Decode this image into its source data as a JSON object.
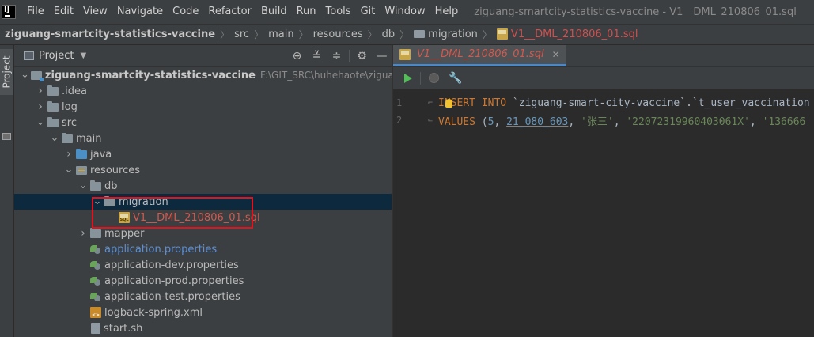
{
  "menubar": {
    "items": [
      "File",
      "Edit",
      "View",
      "Navigate",
      "Code",
      "Refactor",
      "Build",
      "Run",
      "Tools",
      "Git",
      "Window",
      "Help"
    ],
    "window_title": "ziguang-smartcity-statistics-vaccine - V1__DML_210806_01.sql"
  },
  "breadcrumb": {
    "items": [
      "ziguang-smartcity-statistics-vaccine",
      "src",
      "main",
      "resources",
      "db",
      "migration",
      "V1__DML_210806_01.sql"
    ]
  },
  "toolstrip": {
    "project_tab": "Project"
  },
  "project_panel": {
    "title": "Project",
    "tree": [
      {
        "depth": 0,
        "arrow": "open",
        "icon": "module",
        "label": "ziguang-smartcity-statistics-vaccine",
        "style": "bold",
        "path": "F:\\GIT_SRC\\huhehaote\\ziguang-smar"
      },
      {
        "depth": 1,
        "arrow": "closed",
        "icon": "folder",
        "label": ".idea",
        "style": ""
      },
      {
        "depth": 1,
        "arrow": "closed",
        "icon": "folder",
        "label": "log",
        "style": ""
      },
      {
        "depth": 1,
        "arrow": "open",
        "icon": "folder",
        "label": "src",
        "style": ""
      },
      {
        "depth": 2,
        "arrow": "open",
        "icon": "folder",
        "label": "main",
        "style": ""
      },
      {
        "depth": 3,
        "arrow": "closed",
        "icon": "src-folder",
        "label": "java",
        "style": ""
      },
      {
        "depth": 3,
        "arrow": "open",
        "icon": "res-folder",
        "label": "resources",
        "style": ""
      },
      {
        "depth": 4,
        "arrow": "open",
        "icon": "folder",
        "label": "db",
        "style": ""
      },
      {
        "depth": 5,
        "arrow": "open",
        "icon": "folder",
        "label": "migration",
        "style": "",
        "selected": true
      },
      {
        "depth": 6,
        "arrow": "none",
        "icon": "sql",
        "label": "V1__DML_210806_01.sql",
        "style": "red"
      },
      {
        "depth": 4,
        "arrow": "closed",
        "icon": "folder",
        "label": "mapper",
        "style": ""
      },
      {
        "depth": 4,
        "arrow": "none",
        "icon": "props",
        "label": "application.properties",
        "style": "blue"
      },
      {
        "depth": 4,
        "arrow": "none",
        "icon": "props",
        "label": "application-dev.properties",
        "style": ""
      },
      {
        "depth": 4,
        "arrow": "none",
        "icon": "props",
        "label": "application-prod.properties",
        "style": ""
      },
      {
        "depth": 4,
        "arrow": "none",
        "icon": "props",
        "label": "application-test.properties",
        "style": ""
      },
      {
        "depth": 4,
        "arrow": "none",
        "icon": "xml",
        "label": "logback-spring.xml",
        "style": ""
      },
      {
        "depth": 4,
        "arrow": "none",
        "icon": "sh",
        "label": "start.sh",
        "style": ""
      }
    ]
  },
  "editor": {
    "tab_label": "V1__DML_210806_01.sql",
    "lines": [
      {
        "number": "1",
        "tokens": [
          {
            "t": "kw",
            "v": "INSERT INTO "
          },
          {
            "t": "bt",
            "v": "`ziguang-smart-city-vaccine`.`t_user_vaccination"
          }
        ]
      },
      {
        "number": "2",
        "tokens": [
          {
            "t": "kw",
            "v": "VALUES "
          },
          {
            "t": "plain",
            "v": "("
          },
          {
            "t": "num",
            "v": "5"
          },
          {
            "t": "plain",
            "v": ", "
          },
          {
            "t": "num-u",
            "v": "21_080_603"
          },
          {
            "t": "plain",
            "v": ", "
          },
          {
            "t": "str",
            "v": "'张三'"
          },
          {
            "t": "plain",
            "v": ", "
          },
          {
            "t": "str",
            "v": "'22072319960403061X'"
          },
          {
            "t": "plain",
            "v": ", "
          },
          {
            "t": "str",
            "v": "'136666"
          }
        ]
      }
    ]
  },
  "colors": {
    "highlight_box": "#e8101a",
    "keyword": "#cc7832",
    "string": "#6a8759",
    "number": "#6897bb",
    "sql_file": "#d05a50"
  }
}
